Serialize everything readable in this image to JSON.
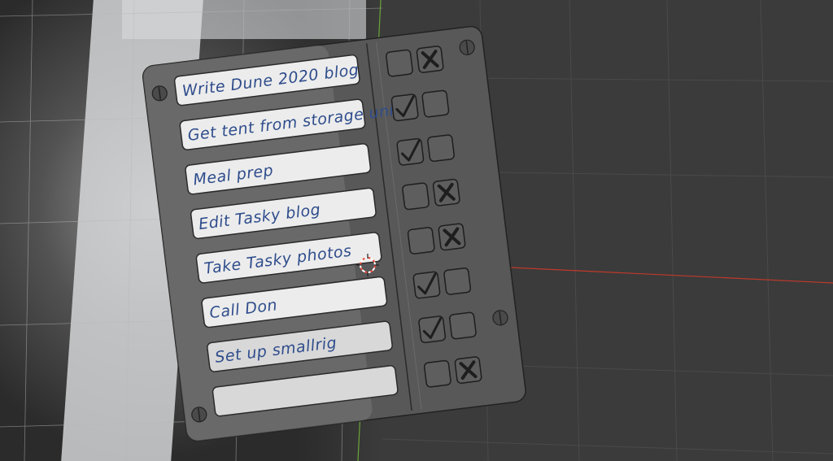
{
  "board": {
    "tasks": [
      {
        "text": "Write Dune 2020 blog",
        "status": "x"
      },
      {
        "text": "Get tent from storage unit",
        "status": "check"
      },
      {
        "text": "Meal prep",
        "status": "check"
      },
      {
        "text": "Edit Tasky blog",
        "status": "x"
      },
      {
        "text": "Take Tasky photos",
        "status": "x"
      },
      {
        "text": "Call Don",
        "status": "check"
      },
      {
        "text": "Set up smallrig",
        "status": "check"
      },
      {
        "text": "",
        "status": "x"
      }
    ]
  },
  "colors": {
    "viewport_bg": "#3b3b3b",
    "board_fill": "#5a5a5a",
    "x_axis": "#c0392b",
    "y_axis": "#6ba539",
    "ink": "#2f4d8c"
  },
  "icons": {
    "cursor": "3d-cursor-icon",
    "check": "checkmark-icon",
    "x": "x-mark-icon",
    "screw": "screw-icon"
  }
}
